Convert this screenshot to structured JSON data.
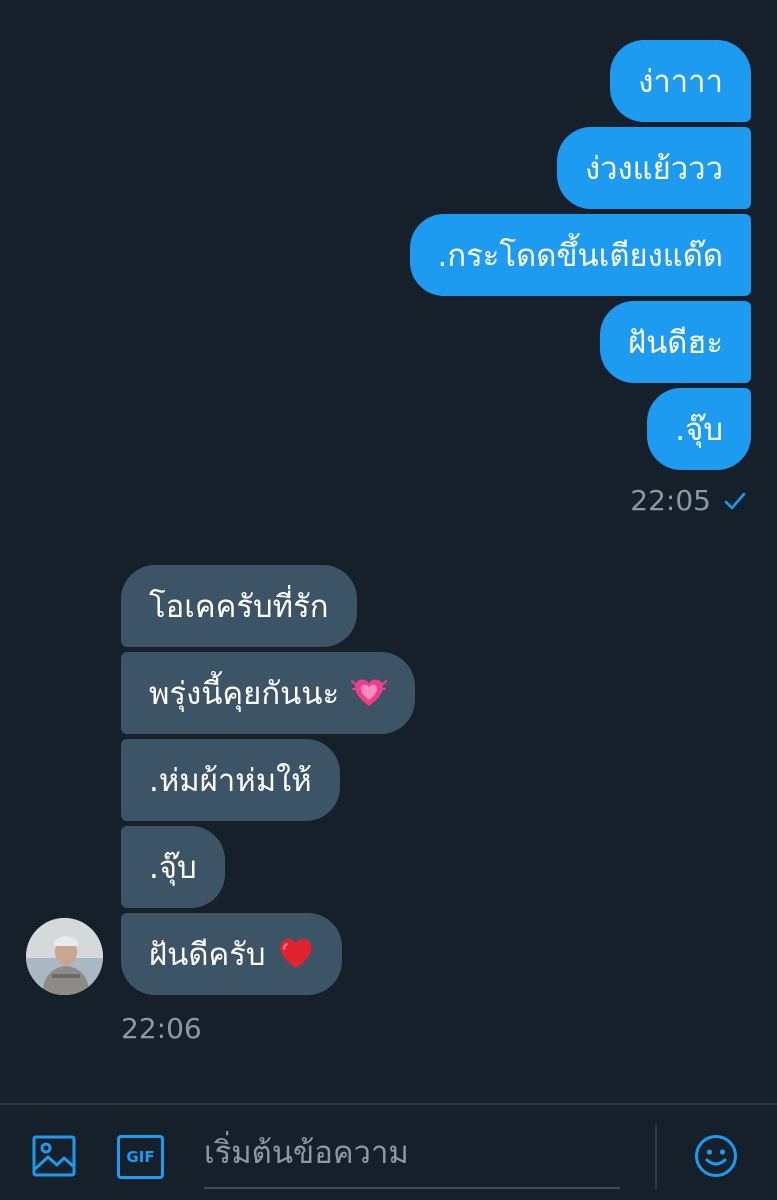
{
  "outgoing": {
    "messages": [
      "ง่าาาา",
      "ง่วงแย้ววว",
      ".กระโดดขึ้นเตียงแด๊ด",
      "ฝันดีฮะ",
      ".จุ๊บ"
    ],
    "time": "22:05",
    "status_icon": "check-icon"
  },
  "incoming": {
    "messages": [
      "โอเคครับที่รัก",
      "พรุ่งนี้คุยกันนะ",
      ".ห่มผ้าห่มให้",
      ".จุ๊บ",
      "ฝันดีครับ"
    ],
    "emoji": {
      "message_2": "💓",
      "message_5": "❤️"
    },
    "time": "22:06"
  },
  "composer": {
    "placeholder": "เริ่มต้นข้อความ",
    "gif_label": "GIF",
    "icons": [
      "image-icon",
      "gif-icon",
      "emoji-icon"
    ]
  },
  "colors": {
    "background": "#15202b",
    "outgoing_bubble": "#1d9bf0",
    "incoming_bubble": "#3d5466",
    "accent": "#1d9bf0",
    "muted_text": "#8b98a5"
  }
}
